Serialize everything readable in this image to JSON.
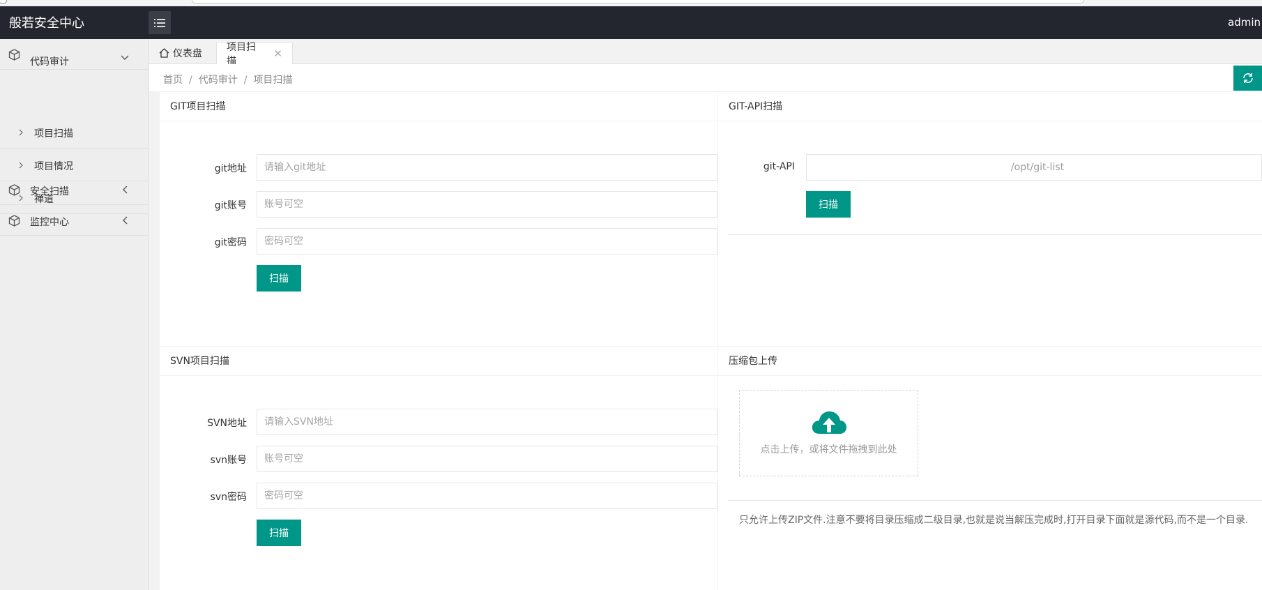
{
  "app": {
    "title": "般若安全中心",
    "user": "admin"
  },
  "sidebar": {
    "groups": [
      {
        "label": "代码审计",
        "expanded": true,
        "icon": "cube-icon",
        "items": [
          {
            "label": "项目扫描"
          },
          {
            "label": "项目情况"
          },
          {
            "label": "禅道"
          }
        ]
      },
      {
        "label": "安全扫描",
        "expanded": false,
        "icon": "cube-icon"
      },
      {
        "label": "监控中心",
        "expanded": false,
        "icon": "cube-icon"
      }
    ]
  },
  "tabs": [
    {
      "label": "仪表盘",
      "icon": "home-icon"
    },
    {
      "label": "项目扫描",
      "active": true,
      "closable": true
    }
  ],
  "breadcrumb": [
    "首页",
    "代码审计",
    "项目扫描"
  ],
  "git_scan": {
    "title": "GIT项目扫描",
    "fields": [
      {
        "label": "git地址",
        "placeholder": "请输入git地址",
        "value": ""
      },
      {
        "label": "git账号",
        "placeholder": "账号可空",
        "value": ""
      },
      {
        "label": "git密码",
        "placeholder": "密码可空",
        "value": ""
      }
    ],
    "button": "扫描"
  },
  "git_api_scan": {
    "title": "GIT-API扫描",
    "label": "git-API",
    "value": "/opt/git-list",
    "button": "扫描"
  },
  "svn_scan": {
    "title": "SVN项目扫描",
    "fields": [
      {
        "label": "SVN地址",
        "placeholder": "请输入SVN地址",
        "value": ""
      },
      {
        "label": "svn账号",
        "placeholder": "账号可空",
        "value": ""
      },
      {
        "label": "svn密码",
        "placeholder": "密码可空",
        "value": ""
      }
    ],
    "button": "扫描"
  },
  "zip_upload": {
    "title": "压缩包上传",
    "upload_text": "点击上传，或将文件拖拽到此处",
    "note": "只允许上传ZIP文件.注意不要将目录压缩成二级目录,也就是说当解压完成时,打开目录下面就是源代码,而不是一个目录."
  },
  "colors": {
    "header_bg": "#23262e",
    "accent": "#009688",
    "sidebar_bg": "#eeeeee"
  }
}
